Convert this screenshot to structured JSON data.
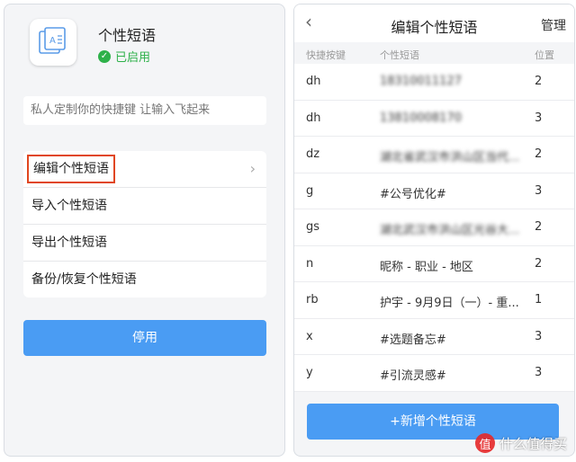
{
  "left": {
    "app": {
      "title": "个性短语",
      "status": "已启用"
    },
    "description": "私人定制你的快捷键 让输入飞起来",
    "menu": [
      {
        "label": "编辑个性短语"
      },
      {
        "label": "导入个性短语"
      },
      {
        "label": "导出个性短语"
      },
      {
        "label": "备份/恢复个性短语"
      }
    ],
    "disable_button": "停用"
  },
  "right": {
    "nav": {
      "back": "‹",
      "title": "编辑个性短语",
      "manage": "管理"
    },
    "columns": {
      "key": "快捷按键",
      "text": "个性短语",
      "position": "位置"
    },
    "rows": [
      {
        "key": "dh",
        "text": "18310011127",
        "position": "2",
        "blurred": true
      },
      {
        "key": "dh",
        "text": "13810008170",
        "position": "3",
        "blurred": true
      },
      {
        "key": "dz",
        "text": "湖北省武汉市洪山区当代...",
        "position": "2",
        "blurred": true
      },
      {
        "key": "g",
        "text": "#公号优化#",
        "position": "3",
        "blurred": false
      },
      {
        "key": "gs",
        "text": "湖北武汉市洪山区光谷大...",
        "position": "2",
        "blurred": true
      },
      {
        "key": "n",
        "text": "昵称 - 职业 - 地区",
        "position": "2",
        "blurred": false
      },
      {
        "key": "rb",
        "text": "护宇 - 9月9日（一）- 重...",
        "position": "1",
        "blurred": false
      },
      {
        "key": "x",
        "text": "#选题备忘#",
        "position": "3",
        "blurred": false
      },
      {
        "key": "y",
        "text": "#引流灵感#",
        "position": "3",
        "blurred": false
      }
    ],
    "add_button": "+新增个性短语"
  },
  "watermark": {
    "logo": "值",
    "text": "什么值得买"
  },
  "colors": {
    "accent": "#4a9cf3",
    "status_green": "#2eb14a",
    "highlight_border": "#e0461f",
    "background": "#f4f5f7"
  },
  "icons": {
    "app_icon": "keyboard-phrase-icon",
    "status_icon": "check-circle-icon",
    "menu_arrow": "chevron-right-icon",
    "back_icon": "chevron-left-icon"
  }
}
